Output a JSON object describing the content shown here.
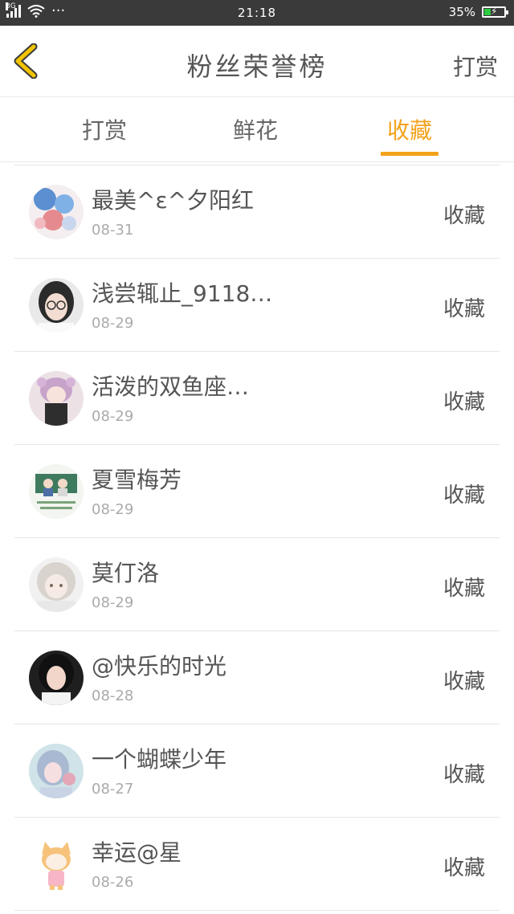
{
  "statusbar": {
    "network": "3G",
    "dots": "···",
    "time": "21:18",
    "battery": "35%",
    "battery_level": 0.35
  },
  "header": {
    "title": "粉丝荣誉榜",
    "right_action": "打赏"
  },
  "tabs": [
    {
      "label": "打赏",
      "active": false
    },
    {
      "label": "鲜花",
      "active": false
    },
    {
      "label": "收藏",
      "active": true
    }
  ],
  "colors": {
    "accent": "#f3a21c",
    "statusbar": "#3a3a3a",
    "back_icon": "#f2c300"
  },
  "rows": [
    {
      "name": "最美^ε^夕阳红",
      "date": "08-31",
      "action": "收藏"
    },
    {
      "name": "浅尝辄止_9118…",
      "date": "08-29",
      "action": "收藏"
    },
    {
      "name": "活泼的双鱼座…",
      "date": "08-29",
      "action": "收藏"
    },
    {
      "name": "夏雪梅芳",
      "date": "08-29",
      "action": "收藏"
    },
    {
      "name": "莫仃洛",
      "date": "08-29",
      "action": "收藏"
    },
    {
      "name": "@快乐的时光",
      "date": "08-28",
      "action": "收藏"
    },
    {
      "name": "一个蝴蝶少年",
      "date": "08-27",
      "action": "收藏"
    },
    {
      "name": "幸运@星",
      "date": "08-26",
      "action": "收藏"
    }
  ]
}
